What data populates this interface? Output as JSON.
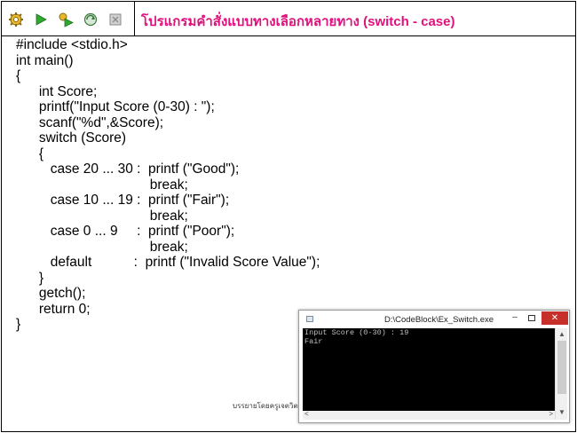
{
  "header": {
    "title": "โปรแกรมคำสั่งแบบทางเลือกหลายทาง (switch - case)",
    "toolbar": [
      {
        "icon": "gear-icon",
        "label": ""
      },
      {
        "icon": "run-icon",
        "label": ""
      },
      {
        "icon": "build-run-icon",
        "label": ""
      },
      {
        "icon": "rebuild-icon",
        "label": ""
      },
      {
        "icon": "stop-icon",
        "label": ""
      }
    ]
  },
  "code": {
    "lines": [
      "#include <stdio.h>",
      "int main()",
      "{",
      "      int Score;",
      "      printf(\"Input Score (0-30) : \");",
      "      scanf(\"%d\",&Score);",
      "      switch (Score)",
      "      {",
      "         case 20 ... 30 :  printf (\"Good\");",
      "                                   break;",
      "         case 10 ... 19 :  printf (\"Fair\");",
      "                                   break;",
      "         case 0 ... 9     :  printf (\"Poor\");",
      "                                   break;",
      "         default           :  printf (\"Invalid Score Value\");",
      "      }",
      "      getch();",
      "      return 0;",
      "}"
    ]
  },
  "footer": {
    "note": "บรรยายโดยครูเจตวิตร์ ..."
  },
  "console": {
    "caption": "D:\\CodeBlock\\Ex_Switch.exe",
    "output": "Input Score (0-30) : 19\nFair",
    "minimize": "–",
    "close": "✕"
  }
}
